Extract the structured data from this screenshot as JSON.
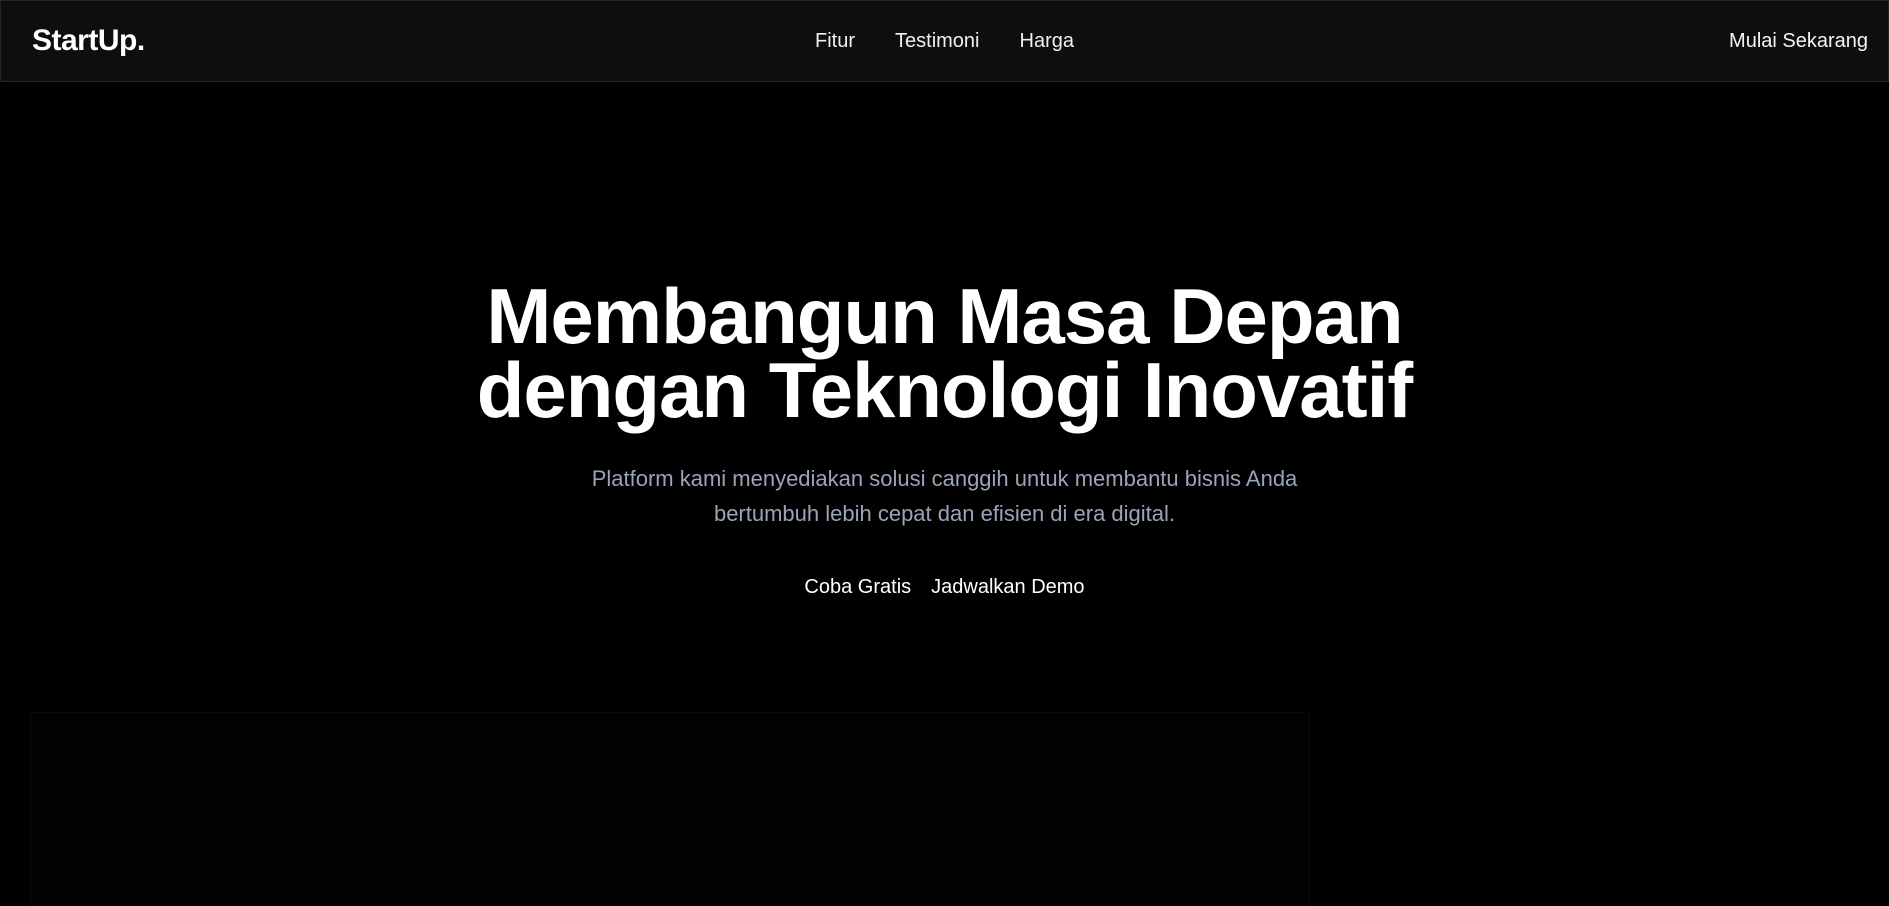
{
  "nav": {
    "logo_text": "StartUp",
    "logo_dot": ".",
    "links": [
      "Fitur",
      "Testimoni",
      "Harga"
    ],
    "cta": "Mulai Sekarang"
  },
  "hero": {
    "title_line1": "Membangun Masa Depan",
    "title_line2": "dengan Teknologi Inovatif",
    "subtitle_line1": "Platform kami menyediakan solusi canggih untuk membantu bisnis Anda",
    "subtitle_line2": "bertumbuh lebih cepat dan efisien di era digital.",
    "primary_button": "Coba Gratis",
    "secondary_button": "Jadwalkan Demo"
  },
  "colors": {
    "background": "#000000",
    "navbar_bg": "#0e0e0e",
    "text": "#ffffff",
    "subtitle": "#9aa4b8"
  }
}
